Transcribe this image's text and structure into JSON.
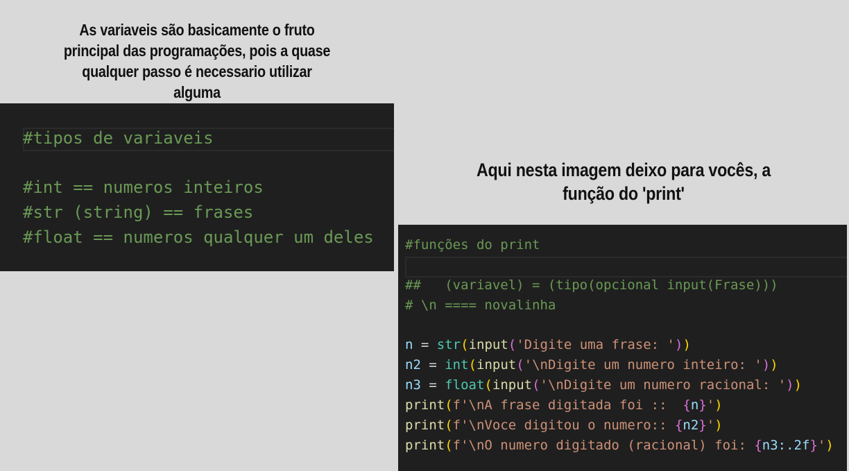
{
  "caption_left": "As variaveis são basicamente o fruto principal das programações, pois a quase qualquer passo é necessario utilizar alguma",
  "caption_right_1": "Aqui nesta imagem deixo para vocês, a",
  "caption_right_2": "função do 'print'",
  "code_left": [
    "#tipos de variaveis",
    "#int == numeros inteiros",
    "#str (string) == frases",
    "#float == numeros qualquer um deles"
  ],
  "code_right_comments": [
    "#funções do print",
    "##   (variavel) = (tipo(opcional input(Frase)))",
    "# \\n ==== novalinha"
  ],
  "code_right_lines": [
    {
      "var": "n",
      "op": " = ",
      "type": "str",
      "s": "'Digite uma frase: '"
    },
    {
      "var": "n2",
      "op": " = ",
      "type": "int",
      "s": "'\\nDigite um numero inteiro: '"
    },
    {
      "var": "n3",
      "op": " = ",
      "type": "float",
      "s": "'\\nDigite um numero racional: '"
    }
  ],
  "code_right_prints": [
    {
      "pre": "f'\\nA frase digitada foi ::  ",
      "v": "n",
      "post": "'"
    },
    {
      "pre": "f'\\nVoce digitou o numero:: ",
      "v": "n2",
      "post": "'"
    },
    {
      "pre": "f'\\nO numero digitado (racional) foi: ",
      "v": "n3:.2f",
      "post": "'"
    }
  ],
  "kw": {
    "input": "input",
    "print": "print"
  },
  "colors": {
    "background": "#d9d9d9",
    "editor": "#1f1f1f",
    "comment": "#6a9955",
    "variable": "#9cdcfe",
    "builtin": "#4ec9b0",
    "function": "#dcdcaa",
    "string": "#ce9178"
  }
}
